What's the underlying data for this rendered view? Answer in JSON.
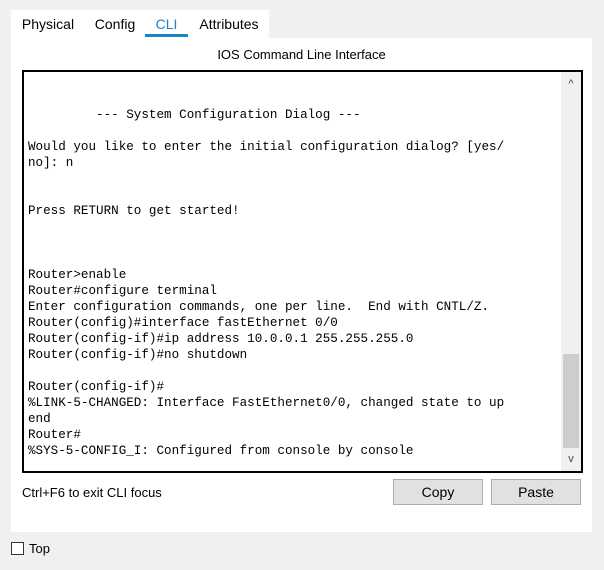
{
  "tabs": [
    {
      "label": "Physical",
      "active": false
    },
    {
      "label": "Config",
      "active": false
    },
    {
      "label": "CLI",
      "active": true
    },
    {
      "label": "Attributes",
      "active": false
    }
  ],
  "panel": {
    "title": "IOS Command Line Interface"
  },
  "terminal": {
    "lines": [
      "",
      "",
      "         --- System Configuration Dialog ---",
      "",
      "Would you like to enter the initial configuration dialog? [yes/",
      "no]: n",
      "",
      "",
      "Press RETURN to get started!",
      "",
      "",
      "",
      "Router>enable",
      "Router#configure terminal",
      "Enter configuration commands, one per line.  End with CNTL/Z.",
      "Router(config)#interface fastEthernet 0/0",
      "Router(config-if)#ip address 10.0.0.1 255.255.255.0",
      "Router(config-if)#no shutdown",
      "",
      "Router(config-if)#",
      "%LINK-5-CHANGED: Interface FastEthernet0/0, changed state to up",
      "end",
      "Router#",
      "%SYS-5-CONFIG_I: Configured from console by console"
    ]
  },
  "scrollbar": {
    "up_icon": "^",
    "down_icon": "v"
  },
  "footer": {
    "hint": "Ctrl+F6 to exit CLI focus",
    "copy_label": "Copy",
    "paste_label": "Paste"
  },
  "top_option": {
    "label": "Top",
    "checked": false
  },
  "colors": {
    "accent": "#1a83c6",
    "background": "#f0f0f0",
    "panel": "#ffffff"
  }
}
